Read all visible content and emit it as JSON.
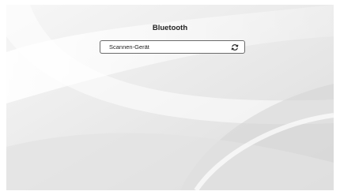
{
  "header": {
    "title": "Bluetooth"
  },
  "scan": {
    "label": "Scannen-Gerät",
    "icon": "refresh-icon"
  },
  "colors": {
    "background": "#e9e9e9",
    "box": "#ffffff",
    "border": "#6b6b6b"
  }
}
